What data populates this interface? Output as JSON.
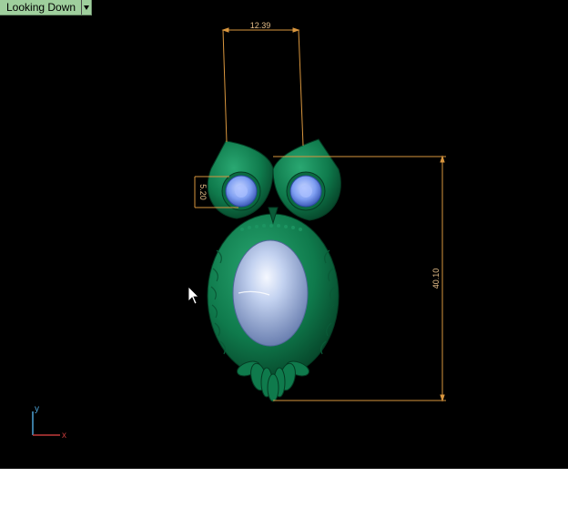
{
  "viewport": {
    "view_name": "Looking Down",
    "dimensions": {
      "width_top": "12.39",
      "eye_diameter": "5.20",
      "height_total": "40.10"
    },
    "axes": {
      "y_label": "y",
      "x_label": "x"
    }
  },
  "colors": {
    "background": "#000000",
    "dimension_line": "#d9963e",
    "owl_body": "#0f7a4c",
    "gem_blue": "#7f9ff2",
    "pearl": "#b6c6e6",
    "axis_y": "#4da3d6",
    "axis_x": "#c23a3a",
    "view_menu_bg": "#9fcf9d"
  }
}
